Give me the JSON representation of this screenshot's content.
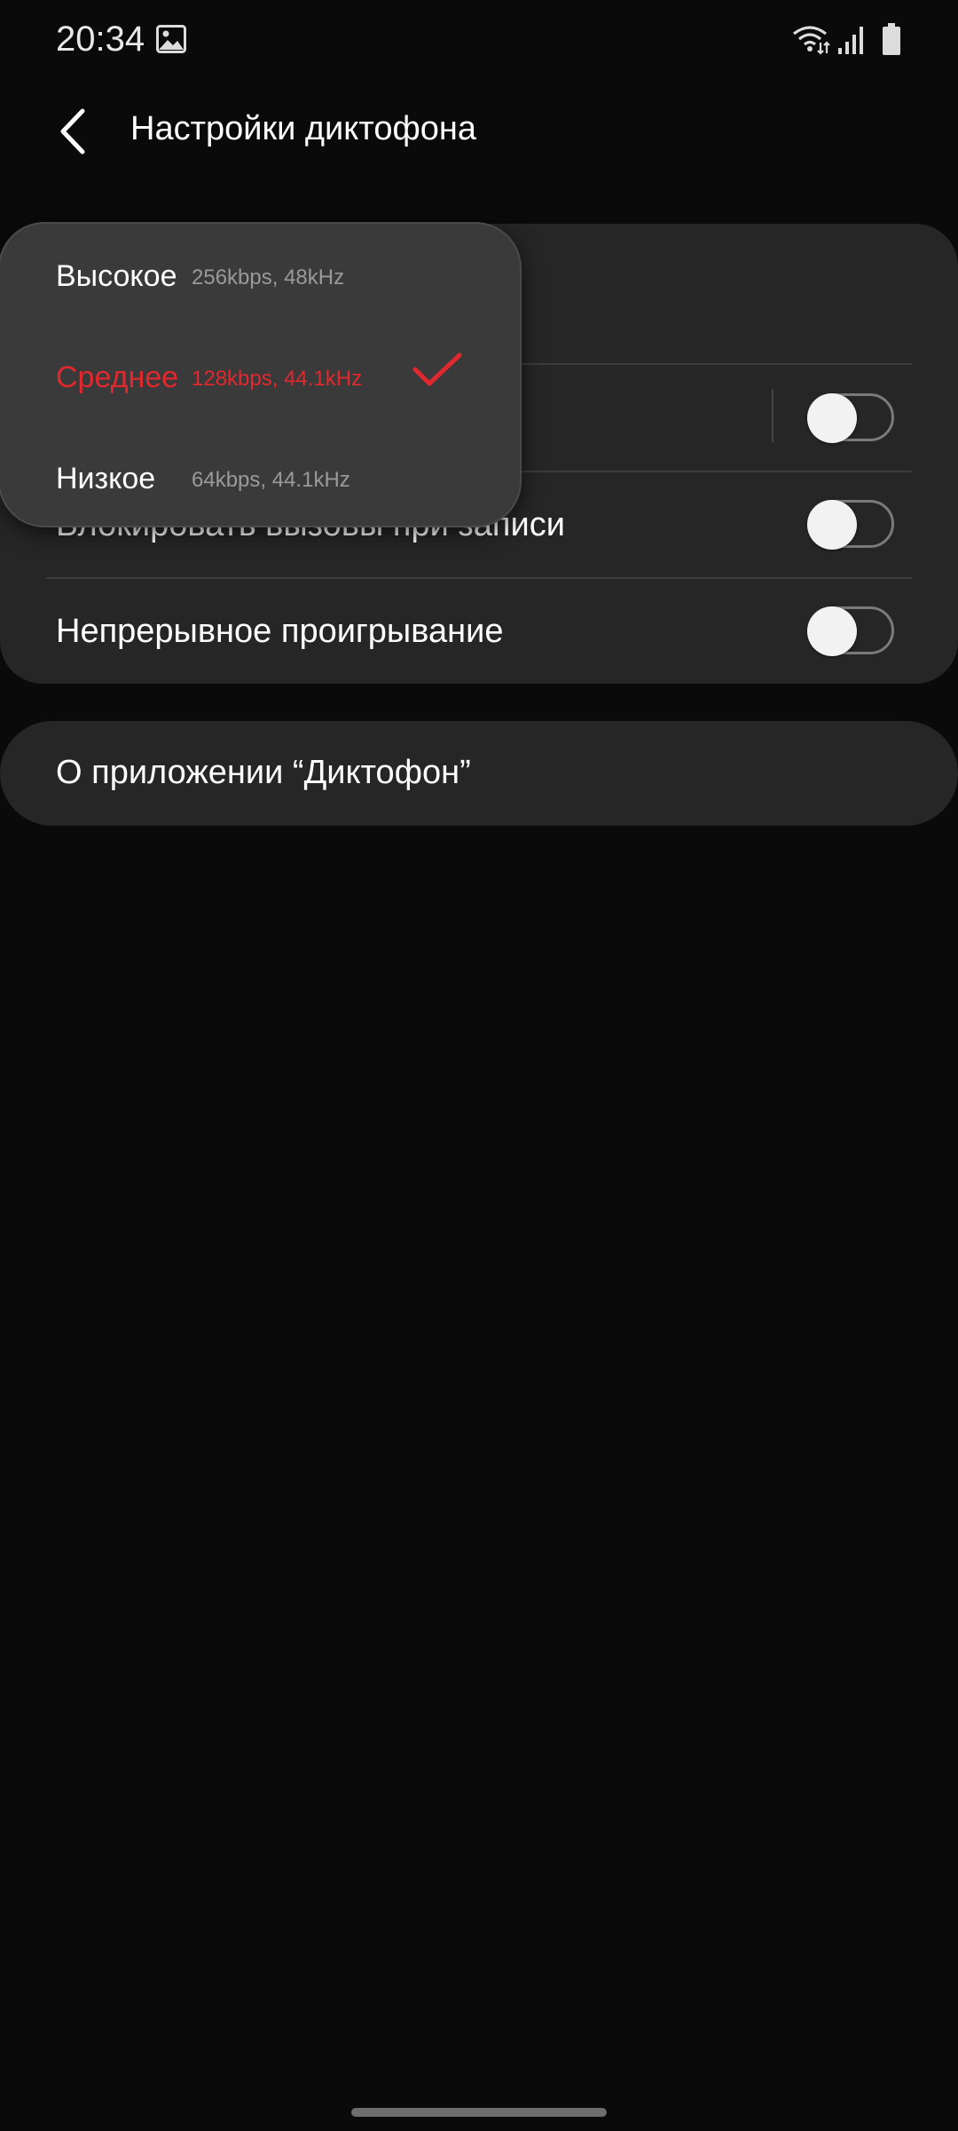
{
  "status_bar": {
    "time": "20:34",
    "icons": [
      "gallery-icon",
      "wifi-icon",
      "signal-icon",
      "battery-icon"
    ]
  },
  "header": {
    "title": "Настройки диктофона",
    "back_icon": "chevron-left-icon"
  },
  "settings": {
    "rows": [
      {
        "label": "Блокировать вызовы при записи",
        "toggle_on": false
      },
      {
        "label": "Непрерывное проигрывание",
        "toggle_on": false
      }
    ],
    "hidden_row_toggle_on": false
  },
  "about": {
    "label": "О приложении “Диктофон”"
  },
  "quality_popup": {
    "items": [
      {
        "name": "Высокое",
        "detail": "256kbps, 48kHz",
        "selected": false
      },
      {
        "name": "Среднее",
        "detail": "128kbps, 44.1kHz",
        "selected": true
      },
      {
        "name": "Низкое",
        "detail": "64kbps, 44.1kHz",
        "selected": false
      }
    ],
    "selected_color": "#e0282e"
  },
  "colors": {
    "background": "#0a0a0a",
    "card": "#262626",
    "popup": "#3a3a3a",
    "accent": "#e0282e",
    "detail_text": "#9a9a9a"
  }
}
